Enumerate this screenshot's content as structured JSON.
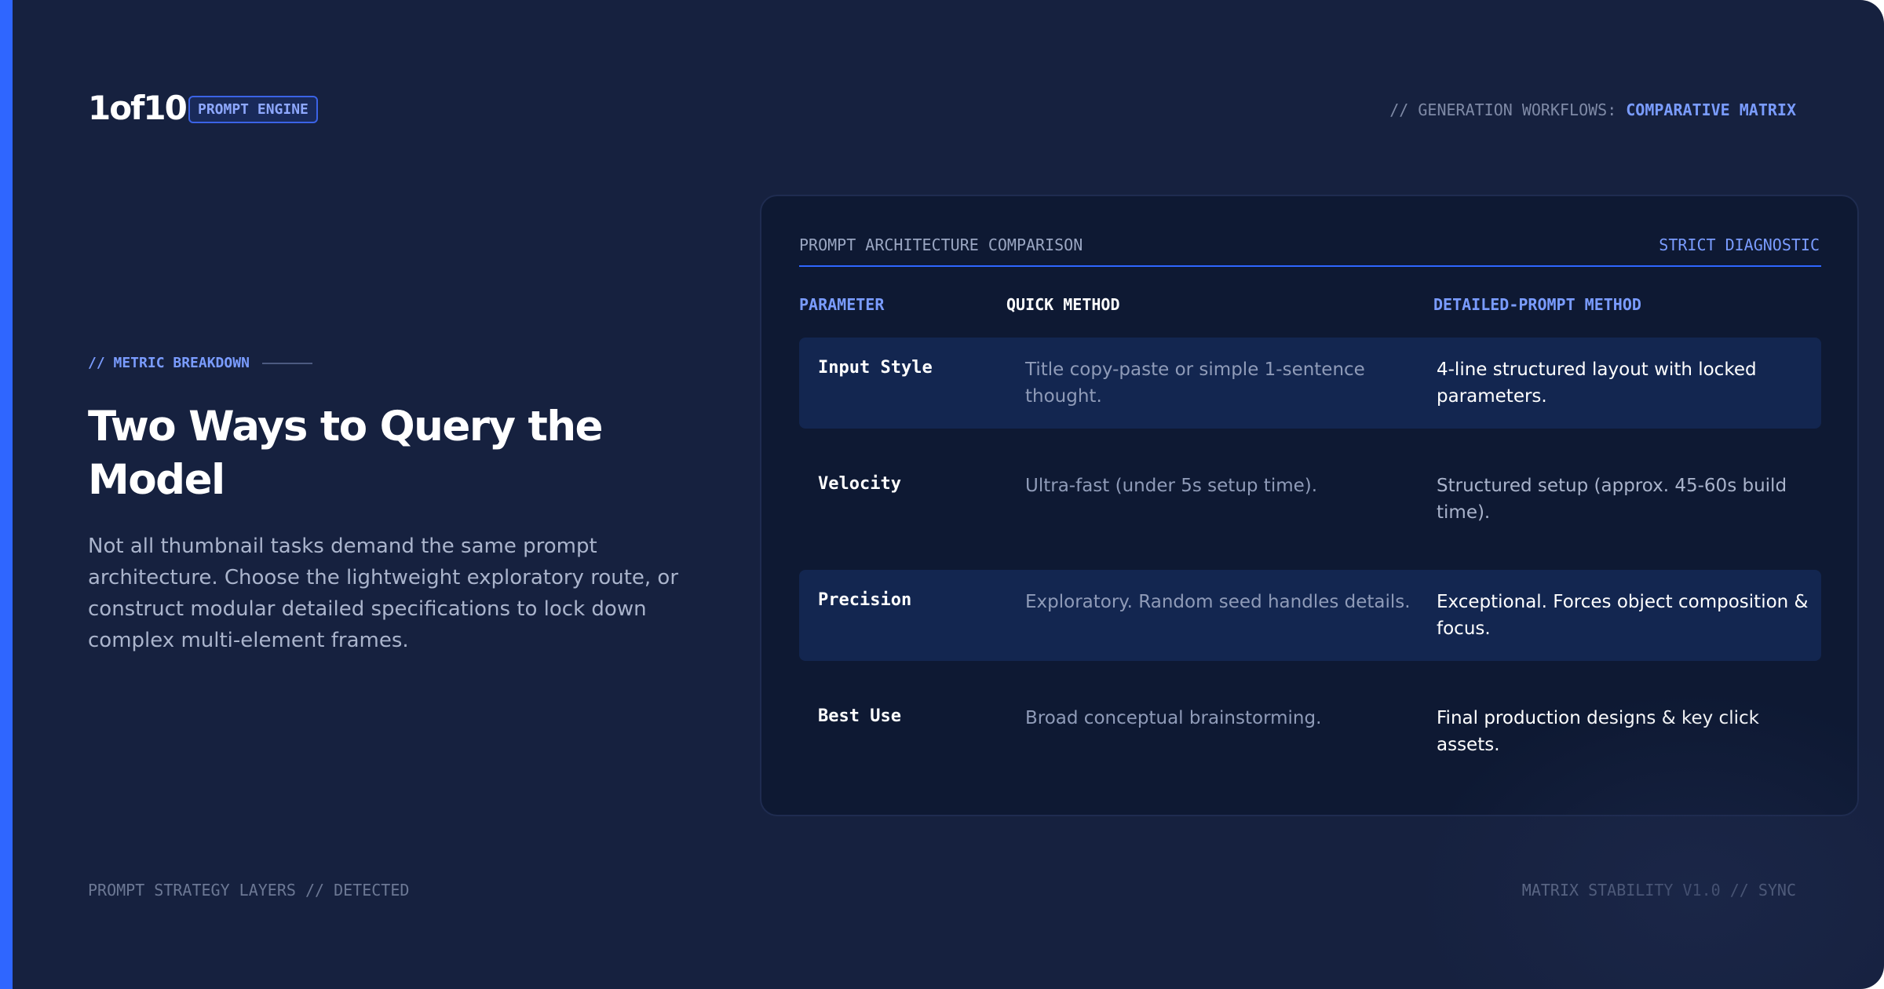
{
  "header": {
    "logo": "1of10",
    "badge": "PROMPT ENGINE",
    "nav_prefix": "// GENERATION WORKFLOWS:",
    "nav_highlight": "COMPARATIVE MATRIX"
  },
  "intro": {
    "eyebrow": "// METRIC BREAKDOWN",
    "title": "Two Ways to Query the Model",
    "body": "Not all thumbnail tasks demand the same prompt architecture. Choose the lightweight exploratory route, or construct modular detailed specifications to lock down complex multi-element frames."
  },
  "panel": {
    "title": "PROMPT ARCHITECTURE COMPARISON",
    "tag": "STRICT DIAGNOSTIC",
    "columns": [
      "PARAMETER",
      "QUICK METHOD",
      "DETAILED-PROMPT METHOD"
    ],
    "rows": [
      {
        "parameter": "Input Style",
        "quick": "Title copy-paste or simple 1-sentence thought.",
        "detailed": "4-line structured layout with locked parameters."
      },
      {
        "parameter": "Velocity",
        "quick": "Ultra-fast (under 5s setup time).",
        "detailed": "Structured setup (approx. 45-60s build time)."
      },
      {
        "parameter": "Precision",
        "quick": "Exploratory. Random seed handles details.",
        "detailed": "Exceptional. Forces object composition & focus."
      },
      {
        "parameter": "Best Use",
        "quick": "Broad conceptual brainstorming.",
        "detailed": "Final production designs & key click assets."
      }
    ]
  },
  "footer": {
    "left": "PROMPT STRATEGY LAYERS // DETECTED",
    "right": "MATRIX STABILITY V1.0 // SYNC"
  },
  "colors": {
    "background": "#16213f",
    "panel": "#0e1933",
    "accent": "#2f66ff",
    "accent_text": "#7a9cff"
  }
}
